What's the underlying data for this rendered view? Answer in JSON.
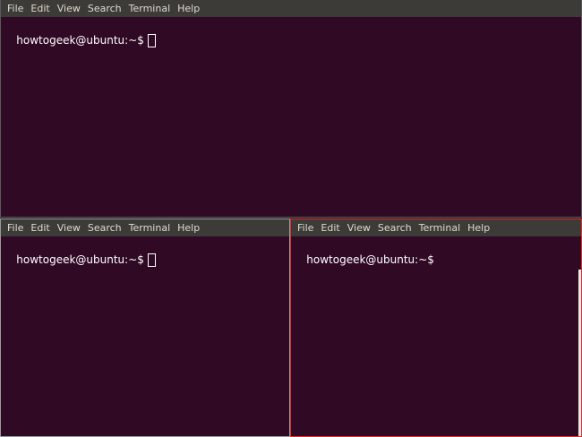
{
  "menu": [
    "File",
    "Edit",
    "View",
    "Search",
    "Terminal",
    "Help"
  ],
  "panes": {
    "top": {
      "prompt": "howtogeek@ubuntu:~$"
    },
    "bottom_left": {
      "prompt": "howtogeek@ubuntu:~$"
    },
    "bottom_right": {
      "prompt": "howtogeek@ubuntu:~$"
    }
  },
  "colors": {
    "terminal_bg": "#300a24",
    "menubar_bg": "#3c3b37",
    "menu_text": "#dfdbd2",
    "focus_border": "#e0302e"
  }
}
